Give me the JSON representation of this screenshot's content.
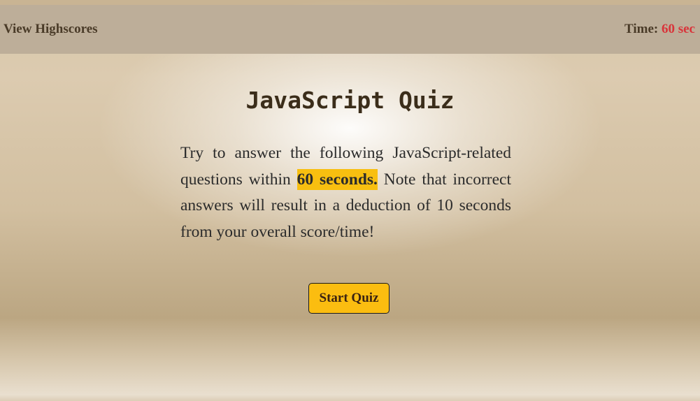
{
  "header": {
    "highscores_label": "View Highscores",
    "time_label": "Time:",
    "time_value": "60 sec"
  },
  "main": {
    "title": "JavaScript Quiz",
    "intro_before": "Try to answer the following JavaScript-related questions within ",
    "intro_highlight": "60 seconds.",
    "intro_after": " Note that incorrect answers will result in a deduction of 10 seconds from your overall score/time!",
    "start_button_label": "Start Quiz"
  },
  "colors": {
    "header_bar": "#bdae99",
    "accent_yellow": "#f8bf10",
    "timer_red": "#d9343a",
    "title_brown": "#3b2d1a"
  }
}
